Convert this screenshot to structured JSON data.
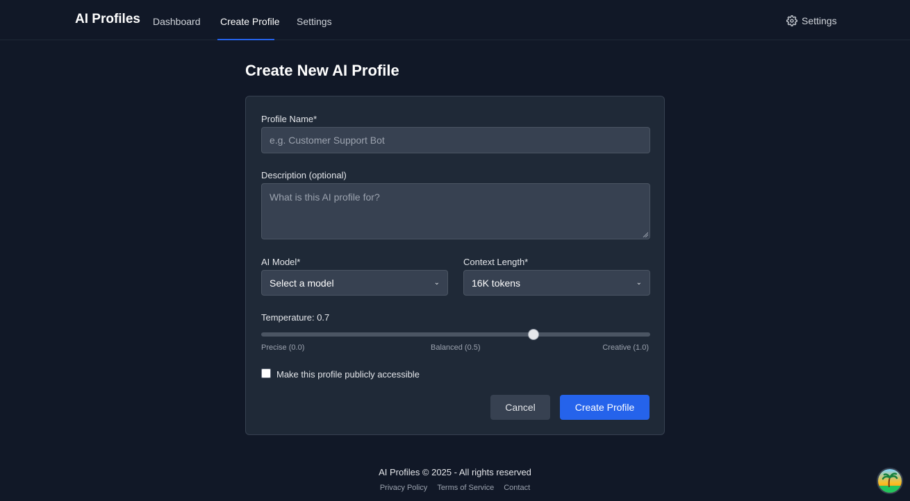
{
  "header": {
    "brand": "AI Profiles",
    "nav": [
      {
        "label": "Dashboard",
        "active": false
      },
      {
        "label": "Create Profile",
        "active": true
      },
      {
        "label": "Settings",
        "active": false
      }
    ],
    "settings_label": "Settings",
    "settings_icon": "gear-icon",
    "accent_color": "#2563eb"
  },
  "page": {
    "title": "Create New AI Profile"
  },
  "form": {
    "profile_name": {
      "label": "Profile Name*",
      "value": "",
      "placeholder": "e.g. Customer Support Bot"
    },
    "description": {
      "label": "Description (optional)",
      "value": "",
      "placeholder": "What is this AI profile for?"
    },
    "model": {
      "label": "AI Model*",
      "selected": "Select a model"
    },
    "context_length": {
      "label": "Context Length*",
      "selected": "16K tokens"
    },
    "temperature": {
      "label": "Temperature: 0.7",
      "value": 0.7,
      "min": 0.0,
      "max": 1.0,
      "ticks": [
        "Precise (0.0)",
        "Balanced (0.5)",
        "Creative (1.0)"
      ]
    },
    "public_checkbox": {
      "label": "Make this profile publicly accessible",
      "checked": false
    },
    "cancel_label": "Cancel",
    "submit_label": "Create Profile"
  },
  "footer": {
    "copyright": "AI Profiles © 2025 - All rights reserved",
    "links": [
      "Privacy Policy",
      "Terms of Service",
      "Contact"
    ]
  }
}
